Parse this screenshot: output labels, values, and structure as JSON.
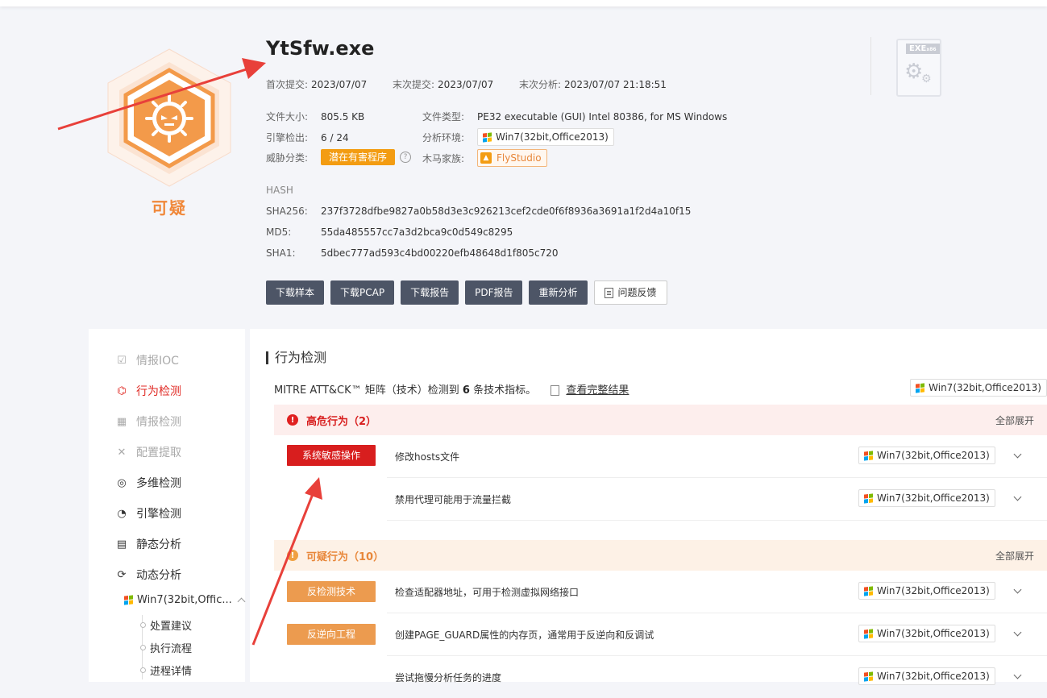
{
  "file": {
    "name": "YtSfw.exe",
    "verdict": "可疑",
    "first_submit_label": "首次提交:",
    "first_submit": "2023/07/07",
    "last_submit_label": "末次提交:",
    "last_submit": "2023/07/07",
    "last_analysis_label": "末次分析:",
    "last_analysis": "2023/07/07 21:18:51",
    "size_label": "文件大小:",
    "size": "805.5 KB",
    "type_label": "文件类型:",
    "type": "PE32 executable (GUI) Intel 80386, for MS Windows",
    "engine_label": "引擎检出:",
    "engine_detect": "6",
    "engine_total": "/ 24",
    "env_label": "分析环境:",
    "env": "Win7(32bit,Office2013)",
    "threat_label": "威胁分类:",
    "threat": "潜在有害程序",
    "family_label": "木马家族:",
    "family": "FlyStudio",
    "exe_badge": "EXE",
    "exe_sub": "x86"
  },
  "hash": {
    "heading": "HASH",
    "sha256_label": "SHA256:",
    "sha256": "237f3728dfbe9827a0b58d3e3c926213cef2cde0f6f8936a3691a1f2d4a10f15",
    "md5_label": "MD5:",
    "md5": "55da485557cc7a3d2bca9c0d549c8295",
    "sha1_label": "SHA1:",
    "sha1": "5dbec777ad593c4bd00220efb48648d1f805c720"
  },
  "actions": {
    "download_sample": "下载样本",
    "download_pcap": "下载PCAP",
    "download_report": "下载报告",
    "pdf_report": "PDF报告",
    "reanalyze": "重新分析",
    "feedback": "问题反馈"
  },
  "sidebar": {
    "items": [
      {
        "label": "情报IOC"
      },
      {
        "label": "行为检测"
      },
      {
        "label": "情报检测"
      },
      {
        "label": "配置提取"
      },
      {
        "label": "多维检测"
      },
      {
        "label": "引擎检测"
      },
      {
        "label": "静态分析"
      },
      {
        "label": "动态分析"
      }
    ],
    "sub_os": "Win7(32bit,Offic...",
    "sub_items": [
      {
        "label": "处置建议"
      },
      {
        "label": "执行流程"
      },
      {
        "label": "进程详情"
      }
    ]
  },
  "main": {
    "title": "行为检测",
    "mitre_prefix": "MITRE ATT&CK™ 矩阵（技术）检测到",
    "mitre_count": "6",
    "mitre_suffix": "条技术指标。",
    "mitre_link": "查看完整结果",
    "os": "Win7(32bit,Office2013)",
    "expand_all": "全部展开",
    "groups": [
      {
        "title": "高危行为（2）",
        "category": "系统敏感操作",
        "rows": [
          {
            "text": "修改hosts文件",
            "os": "Win7(32bit,Office2013)"
          },
          {
            "text": "禁用代理可能用于流量拦截",
            "os": "Win7(32bit,Office2013)"
          }
        ]
      },
      {
        "title": "可疑行为（10）",
        "categories": [
          "反检测技术",
          "反逆向工程"
        ],
        "rows": [
          {
            "text": "检查适配器地址，可用于检测虚拟网络接口",
            "os": "Win7(32bit,Office2013)"
          },
          {
            "text": "创建PAGE_GUARD属性的内存页，通常用于反逆向和反调试",
            "os": "Win7(32bit,Office2013)"
          },
          {
            "text": "尝试拖慢分析任务的进度",
            "os": "Win7(32bit,Office2013)"
          }
        ]
      }
    ]
  },
  "colors": {
    "accent_red": "#e02a24",
    "verdict_orange": "#f0883a",
    "button_dark": "#4d5566",
    "annotation_arrow": "#e8403a"
  }
}
